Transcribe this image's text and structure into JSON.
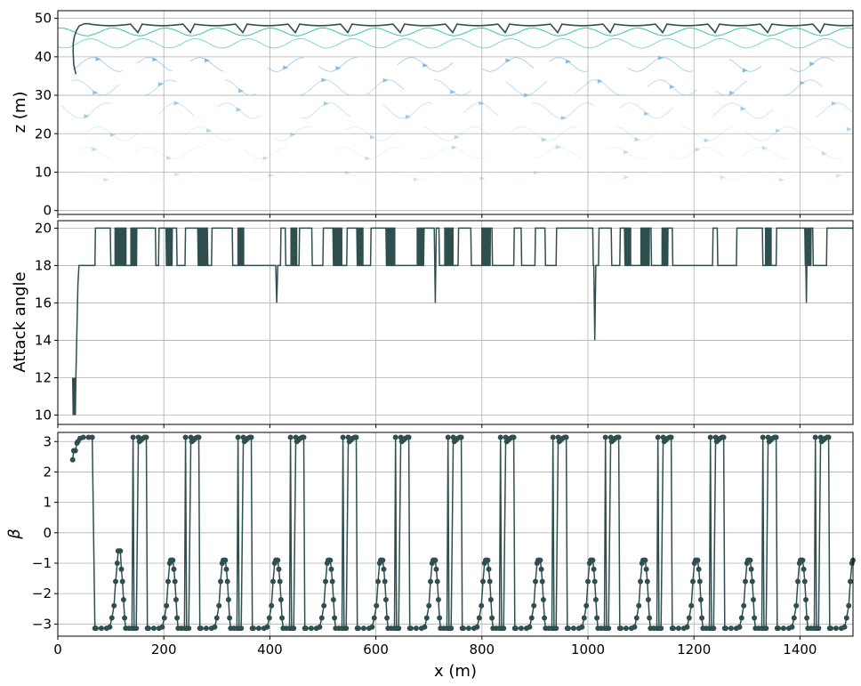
{
  "colors": {
    "series": "#2f4f4f",
    "grid": "#b0b0b0",
    "frame": "#000000",
    "stream_dark": "#1fbf9a",
    "stream_light": "#7ab6e0"
  },
  "chart_data": [
    {
      "id": "trajectory",
      "type": "line",
      "xlabel": "",
      "ylabel": "z (m)",
      "xlim": [
        0,
        1500
      ],
      "ylim": [
        -1,
        52
      ],
      "yticks": [
        0,
        10,
        20,
        30,
        40,
        50
      ],
      "xticks": [
        0,
        200,
        400,
        600,
        800,
        1000,
        1200,
        1400
      ],
      "grid": true,
      "background": "streamlines (wave flow field)",
      "series": [
        {
          "description": "glider path: starts near (30,35), rises to ~48 then repeated dives ~100 m apart",
          "x_start": 30,
          "period_m": 99,
          "z_crest": 48.5,
          "z_trough": 46.3
        }
      ]
    },
    {
      "id": "attack_angle",
      "type": "line",
      "xlabel": "",
      "ylabel": "Attack angle",
      "xlim": [
        0,
        1500
      ],
      "ylim": [
        9.5,
        20.4
      ],
      "yticks": [
        10,
        12,
        14,
        16,
        18,
        20
      ],
      "xticks": [
        0,
        200,
        400,
        600,
        800,
        1000,
        1200,
        1400
      ],
      "grid": true,
      "series": [
        {
          "description": "mostly 20 with drops to 18; dips to 16 at ~413, ~712, ~1412; dip to 14 at ~1013; start at 10-12 near x=30",
          "segments_at_18": [
            [
              40,
              70
            ],
            [
              100,
              140
            ],
            [
              185,
              190
            ],
            [
              225,
              240
            ],
            [
              283,
              290
            ],
            [
              330,
              420
            ],
            [
              430,
              455
            ],
            [
              480,
              500
            ],
            [
              520,
              545
            ],
            [
              575,
              590
            ],
            [
              620,
              690
            ],
            [
              720,
              755
            ],
            [
              780,
              810
            ],
            [
              820,
              860
            ],
            [
              875,
              900
            ],
            [
              920,
              940
            ],
            [
              1010,
              1020
            ],
            [
              1045,
              1060
            ],
            [
              1078,
              1100
            ],
            [
              1120,
              1140
            ],
            [
              1160,
              1235
            ],
            [
              1245,
              1280
            ],
            [
              1330,
              1355
            ],
            [
              1425,
              1450
            ]
          ]
        }
      ]
    },
    {
      "id": "beta",
      "type": "line",
      "xlabel": "x (m)",
      "ylabel": "β",
      "xlim": [
        0,
        1500
      ],
      "ylim": [
        -3.4,
        3.3
      ],
      "yticks": [
        -3,
        -2,
        -1,
        0,
        1,
        2,
        3
      ],
      "xticks": [
        0,
        200,
        400,
        600,
        800,
        1000,
        1200,
        1400
      ],
      "xticklabels": [
        "0",
        "200",
        "400",
        "600",
        "800",
        "1000",
        "1200",
        "1400"
      ],
      "grid": true,
      "markers": "circle",
      "series": [
        {
          "description": "periodic switching between about 3.14 and -3.14 with intermediate peaks near -0.9 every ~100 m",
          "start": [
            [
              28,
              2.4
            ],
            [
              30,
              2.7
            ],
            [
              33,
              2.7
            ],
            [
              36,
              2.95
            ]
          ],
          "period_m": 99,
          "peak_value": -0.9
        }
      ]
    }
  ]
}
